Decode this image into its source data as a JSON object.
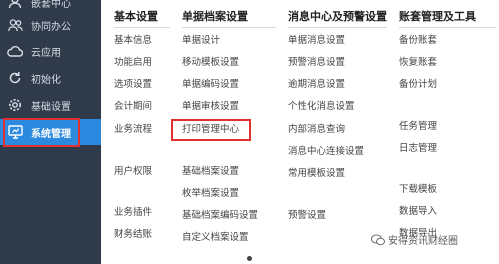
{
  "sidebar": {
    "items": [
      {
        "label": "嵌套中心",
        "icon": "person-icon"
      },
      {
        "label": "协同办公",
        "icon": "people-icon"
      },
      {
        "label": "云应用",
        "icon": "cloud-icon"
      },
      {
        "label": "初始化",
        "icon": "refresh-icon"
      },
      {
        "label": "基础设置",
        "icon": "gear-icon"
      },
      {
        "label": "系统管理",
        "icon": "monitor-icon"
      }
    ],
    "active_index": 5
  },
  "menu": {
    "columns": [
      {
        "title": "基本设置",
        "items": [
          "基本信息",
          "功能启用",
          "选项设置",
          "会计期间",
          "业务流程",
          "用户权限",
          "业务插件",
          "财务结账"
        ]
      },
      {
        "title": "单据档案设置",
        "items": [
          "单据设计",
          "移动模板设置",
          "单据编码设置",
          "单据审核设置",
          "打印管理中心",
          "基础档案设置",
          "枚举档案设置",
          "基础档案编码设置",
          "自定义档案设置"
        ]
      },
      {
        "title": "消息中心及预警设置",
        "items": [
          "单据消息设置",
          "预警消息设置",
          "逾期消息设置",
          "个性化消息设置",
          "内部消息查询",
          "消息中心连接设置",
          "常用模板设置",
          "预警设置"
        ]
      },
      {
        "title": "账套管理及工具",
        "items": [
          "备份账套",
          "恢复账套",
          "备份计划",
          "任务管理",
          "日志管理",
          "下载模板",
          "数据导入",
          "数据导出"
        ]
      }
    ]
  },
  "watermark": "安得资讯财经圈",
  "colors": {
    "sidebar_bg": "#2f3a4b",
    "active_bg": "#2b89e0",
    "highlight_border": "#e03030"
  }
}
